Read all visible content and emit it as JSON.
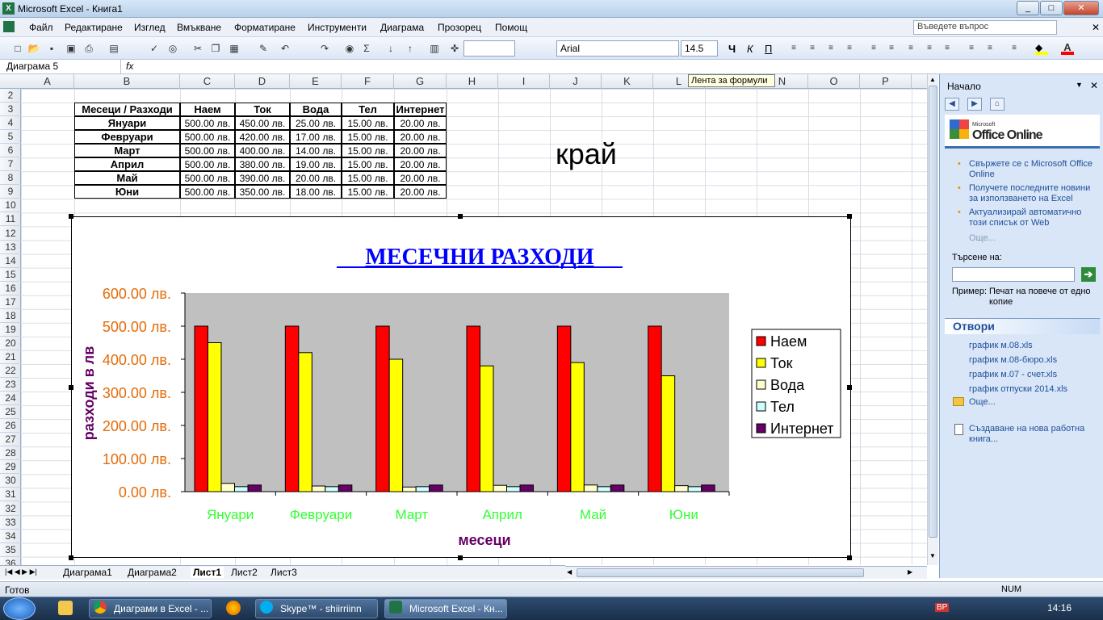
{
  "window": {
    "title": "Microsoft Excel - Книга1",
    "min": "_",
    "max": "□",
    "close": "✕"
  },
  "menu": [
    "Файл",
    "Редактиране",
    "Изглед",
    "Вмъкване",
    "Форматиране",
    "Инструменти",
    "Диаграма",
    "Прозорец",
    "Помощ"
  ],
  "ask_placeholder": "Въведете въпрос",
  "toolbar": {
    "font": "Arial",
    "size": "14.5"
  },
  "namebox": "Диаграма 5",
  "fx": "fx",
  "tooltip": "Лента за формули",
  "columns": [
    "A",
    "B",
    "C",
    "D",
    "E",
    "F",
    "G",
    "H",
    "I",
    "J",
    "K",
    "L",
    "M",
    "N",
    "O",
    "P"
  ],
  "rows": [
    "2",
    "3",
    "4",
    "5",
    "6",
    "7",
    "8",
    "9",
    "10",
    "11",
    "12",
    "13",
    "14",
    "15",
    "16",
    "17",
    "18",
    "19",
    "20",
    "21",
    "22",
    "23",
    "24",
    "25",
    "26",
    "27",
    "28",
    "29",
    "30",
    "31",
    "32",
    "33",
    "34",
    "35",
    "36"
  ],
  "table": {
    "headers": [
      "Месеци / Разходи",
      "Наем",
      "Ток",
      "Вода",
      "Тел",
      "Интернет"
    ],
    "rows": [
      [
        "Януари",
        "500.00 лв.",
        "450.00 лв.",
        "25.00 лв.",
        "15.00 лв.",
        "20.00 лв."
      ],
      [
        "Февруари",
        "500.00 лв.",
        "420.00 лв.",
        "17.00 лв.",
        "15.00 лв.",
        "20.00 лв."
      ],
      [
        "Март",
        "500.00 лв.",
        "400.00 лв.",
        "14.00 лв.",
        "15.00 лв.",
        "20.00 лв."
      ],
      [
        "Април",
        "500.00 лв.",
        "380.00 лв.",
        "19.00 лв.",
        "15.00 лв.",
        "20.00 лв."
      ],
      [
        "Май",
        "500.00 лв.",
        "390.00 лв.",
        "20.00 лв.",
        "15.00 лв.",
        "20.00 лв."
      ],
      [
        "Юни",
        "500.00 лв.",
        "350.00 лв.",
        "18.00 лв.",
        "15.00 лв.",
        "20.00 лв."
      ]
    ]
  },
  "free_text": "край",
  "chart_data": {
    "type": "bar",
    "title": "МЕСЕЧНИ РАЗХОДИ",
    "xlabel": "месеци",
    "ylabel": "разходи в лв",
    "categories": [
      "Януари",
      "Февруари",
      "Март",
      "Април",
      "Май",
      "Юни"
    ],
    "series": [
      {
        "name": "Наем",
        "color": "#ff0000",
        "values": [
          500,
          500,
          500,
          500,
          500,
          500
        ]
      },
      {
        "name": "Ток",
        "color": "#ffff00",
        "values": [
          450,
          420,
          400,
          380,
          390,
          350
        ]
      },
      {
        "name": "Вода",
        "color": "#ffffcc",
        "values": [
          25,
          17,
          14,
          19,
          20,
          18
        ]
      },
      {
        "name": "Тел",
        "color": "#ccffff",
        "values": [
          15,
          15,
          15,
          15,
          15,
          15
        ]
      },
      {
        "name": "Интернет",
        "color": "#660066",
        "values": [
          20,
          20,
          20,
          20,
          20,
          20
        ]
      }
    ],
    "yticks": [
      "0.00 лв.",
      "100.00 лв.",
      "200.00 лв.",
      "300.00 лв.",
      "400.00 лв.",
      "500.00 лв.",
      "600.00 лв."
    ],
    "ylim": [
      0,
      600
    ],
    "plot_bg": "#c0c0c0",
    "tick_color": "#e46c0a",
    "cat_color": "#33ff33",
    "title_color": "#0000ff",
    "label_color": "#660066",
    "legend_position": "right",
    "grid": false
  },
  "sheet_tabs": [
    "Диаграма1",
    "Диаграма2",
    "Лист1",
    "Лист2",
    "Лист3"
  ],
  "active_tab": "Лист1",
  "status": {
    "left": "Готов",
    "num": "NUM"
  },
  "pane": {
    "title": "Начало",
    "brand_small": "Microsoft",
    "brand": "Office Online",
    "links": [
      "Свържете се с Microsoft Office Online",
      "Получете последните новини за използването на Excel",
      "Актуализирай автоматично този списък от Web"
    ],
    "more": "Още...",
    "search_label": "Търсене на:",
    "example_label": "Пример:",
    "example_text": "Печат на повече от едно копие",
    "open_title": "Отвори",
    "files": [
      "график м.08.xls",
      "график м.08-бюро.xls",
      "график м.07 - счет.xls",
      "график отпуски 2014.xls"
    ],
    "more2": "Още...",
    "new_workbook": "Създаване на нова работна книга..."
  },
  "taskbar": {
    "items": [
      "Диаграми в Excel - ...",
      "Skype™ - shiirriinn",
      "Microsoft Excel - Кн..."
    ],
    "tray_lang": "BP",
    "clock": "14:16"
  }
}
